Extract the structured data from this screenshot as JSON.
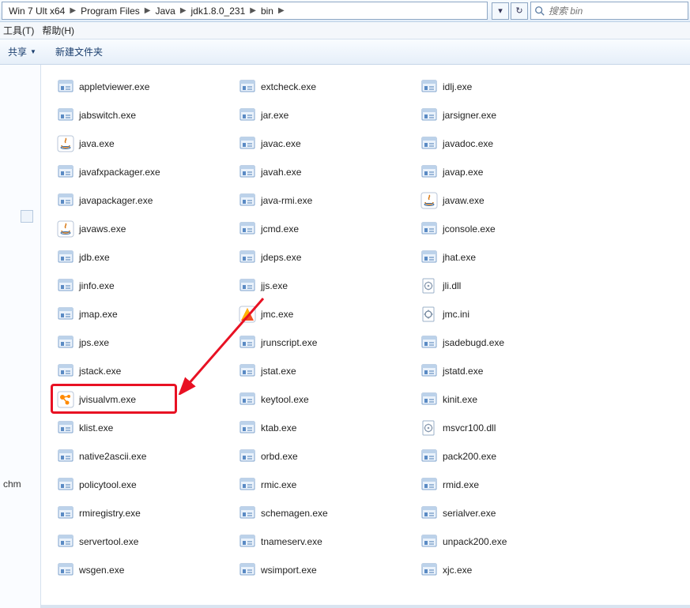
{
  "breadcrumb": [
    "Win 7 Ult x64",
    "Program Files",
    "Java",
    "jdk1.8.0_231",
    "bin"
  ],
  "search_placeholder": "搜索 bin",
  "menubar": {
    "tools": "工具(T)",
    "help": "帮助(H)"
  },
  "toolbar": {
    "share": "共享",
    "newfolder": "新建文件夹"
  },
  "sidebar_label": "chm",
  "files": [
    {
      "name": "appletviewer.exe",
      "icon": "exe"
    },
    {
      "name": "extcheck.exe",
      "icon": "exe"
    },
    {
      "name": "idlj.exe",
      "icon": "exe"
    },
    {
      "name": "jabswitch.exe",
      "icon": "exe"
    },
    {
      "name": "jar.exe",
      "icon": "exe"
    },
    {
      "name": "jarsigner.exe",
      "icon": "exe"
    },
    {
      "name": "java.exe",
      "icon": "java"
    },
    {
      "name": "javac.exe",
      "icon": "exe"
    },
    {
      "name": "javadoc.exe",
      "icon": "exe"
    },
    {
      "name": "javafxpackager.exe",
      "icon": "exe"
    },
    {
      "name": "javah.exe",
      "icon": "exe"
    },
    {
      "name": "javap.exe",
      "icon": "exe"
    },
    {
      "name": "javapackager.exe",
      "icon": "exe"
    },
    {
      "name": "java-rmi.exe",
      "icon": "exe"
    },
    {
      "name": "javaw.exe",
      "icon": "java"
    },
    {
      "name": "javaws.exe",
      "icon": "java"
    },
    {
      "name": "jcmd.exe",
      "icon": "exe"
    },
    {
      "name": "jconsole.exe",
      "icon": "exe"
    },
    {
      "name": "jdb.exe",
      "icon": "exe"
    },
    {
      "name": "jdeps.exe",
      "icon": "exe"
    },
    {
      "name": "jhat.exe",
      "icon": "exe"
    },
    {
      "name": "jinfo.exe",
      "icon": "exe"
    },
    {
      "name": "jjs.exe",
      "icon": "exe"
    },
    {
      "name": "jli.dll",
      "icon": "dll"
    },
    {
      "name": "jmap.exe",
      "icon": "exe"
    },
    {
      "name": "jmc.exe",
      "icon": "jmc"
    },
    {
      "name": "jmc.ini",
      "icon": "ini"
    },
    {
      "name": "jps.exe",
      "icon": "exe"
    },
    {
      "name": "jrunscript.exe",
      "icon": "exe"
    },
    {
      "name": "jsadebugd.exe",
      "icon": "exe"
    },
    {
      "name": "jstack.exe",
      "icon": "exe"
    },
    {
      "name": "jstat.exe",
      "icon": "exe"
    },
    {
      "name": "jstatd.exe",
      "icon": "exe"
    },
    {
      "name": "jvisualvm.exe",
      "icon": "jvvm",
      "highlight": true
    },
    {
      "name": "keytool.exe",
      "icon": "exe"
    },
    {
      "name": "kinit.exe",
      "icon": "exe"
    },
    {
      "name": "klist.exe",
      "icon": "exe"
    },
    {
      "name": "ktab.exe",
      "icon": "exe"
    },
    {
      "name": "msvcr100.dll",
      "icon": "dll"
    },
    {
      "name": "native2ascii.exe",
      "icon": "exe"
    },
    {
      "name": "orbd.exe",
      "icon": "exe"
    },
    {
      "name": "pack200.exe",
      "icon": "exe"
    },
    {
      "name": "policytool.exe",
      "icon": "exe"
    },
    {
      "name": "rmic.exe",
      "icon": "exe"
    },
    {
      "name": "rmid.exe",
      "icon": "exe"
    },
    {
      "name": "rmiregistry.exe",
      "icon": "exe"
    },
    {
      "name": "schemagen.exe",
      "icon": "exe"
    },
    {
      "name": "serialver.exe",
      "icon": "exe"
    },
    {
      "name": "servertool.exe",
      "icon": "exe"
    },
    {
      "name": "tnameserv.exe",
      "icon": "exe"
    },
    {
      "name": "unpack200.exe",
      "icon": "exe"
    },
    {
      "name": "wsgen.exe",
      "icon": "exe"
    },
    {
      "name": "wsimport.exe",
      "icon": "exe"
    },
    {
      "name": "xjc.exe",
      "icon": "exe"
    }
  ],
  "colors": {
    "highlight": "#e81123",
    "link": "#1a3e6e"
  }
}
